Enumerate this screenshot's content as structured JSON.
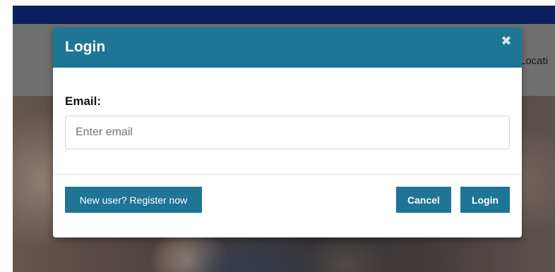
{
  "background": {
    "nav_partial_item": "Locati"
  },
  "modal": {
    "title": "Login",
    "close_icon": "close-icon",
    "close_glyph": "✖",
    "email_label": "Email:",
    "email_value": "",
    "email_placeholder": "Enter email",
    "register_label": "New user? Register now",
    "cancel_label": "Cancel",
    "login_label": "Login"
  },
  "colors": {
    "topbar": "#0a1f5c",
    "modal_header": "#1e7595",
    "primary_button": "#1e7595"
  }
}
